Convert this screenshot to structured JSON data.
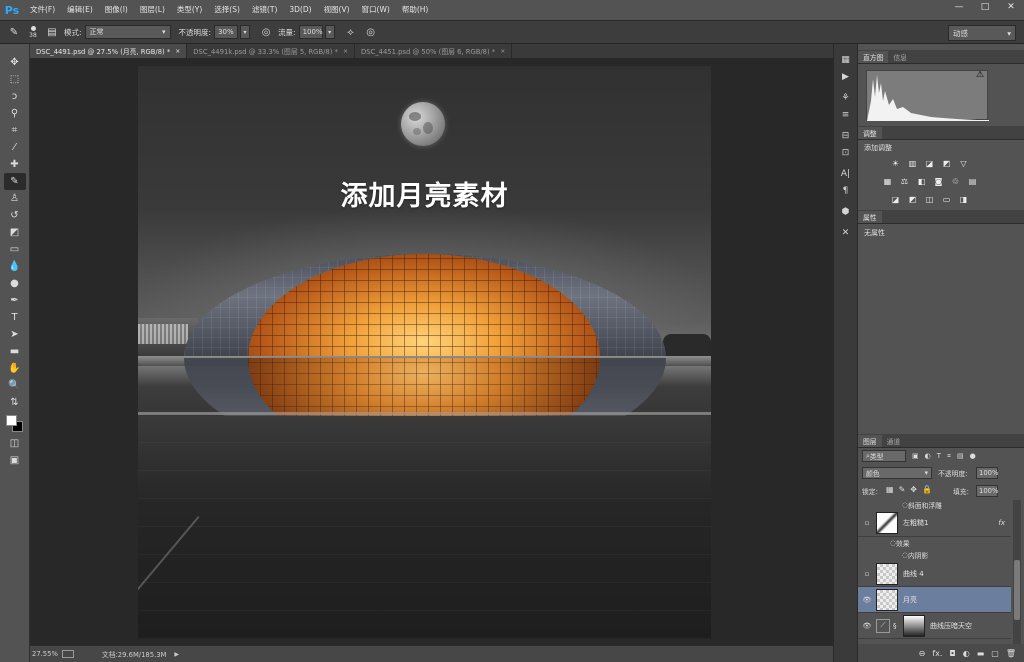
{
  "app": {
    "logo": "Ps",
    "menu": [
      "文件(F)",
      "编辑(E)",
      "图像(I)",
      "图层(L)",
      "类型(Y)",
      "选择(S)",
      "滤镜(T)",
      "3D(D)",
      "视图(V)",
      "窗口(W)",
      "帮助(H)"
    ],
    "window_buttons": [
      "—",
      "□",
      "✕"
    ]
  },
  "options_bar": {
    "brush_size": "38",
    "mode_label": "模式:",
    "mode_value": "正常",
    "opacity_label": "不透明度:",
    "opacity_value": "30%",
    "flow_label": "流量:",
    "flow_value": "100%",
    "workspace": "动感"
  },
  "doc_tabs": [
    {
      "label": "DSC_4491.psd @ 27.5% (月亮, RGB/8) *",
      "active": true
    },
    {
      "label": "DSC_4491k.psd @ 33.3% (图层 5, RGB/8) *",
      "active": false
    },
    {
      "label": "DSC_4451.psd @ 50% (图层 6, RGB/8) *",
      "active": false
    }
  ],
  "canvas": {
    "title_text": "添加月亮素材"
  },
  "status_bar": {
    "zoom": "27.55%",
    "doc_info": "文档:29.6M/185.3M"
  },
  "panels": {
    "histogram": {
      "tabs": [
        "直方图",
        "信息"
      ]
    },
    "adjustments": {
      "tabs": [
        "调整"
      ],
      "title": "添加调整"
    },
    "properties": {
      "tabs": [
        "属性"
      ],
      "text": "无属性"
    },
    "layers": {
      "tabs": [
        "图层",
        "通道"
      ],
      "filter": "类型",
      "blend_mode": "颜色",
      "opacity_label": "不透明度:",
      "opacity": "100%",
      "lock_label": "锁定:",
      "fill_label": "填充:",
      "fill": "100%",
      "rows": {
        "top_effect": "斜面和浮雕",
        "layer1": "左粗糙1",
        "effects_label": "效果",
        "inner_shadow": "内阴影",
        "curve4": "曲线 4",
        "moon": "月亮",
        "curve_sky": "曲线压暗天空"
      }
    }
  },
  "colors": {
    "accent_selected": "#6b7e9e",
    "ps_blue": "#31a8ff"
  }
}
